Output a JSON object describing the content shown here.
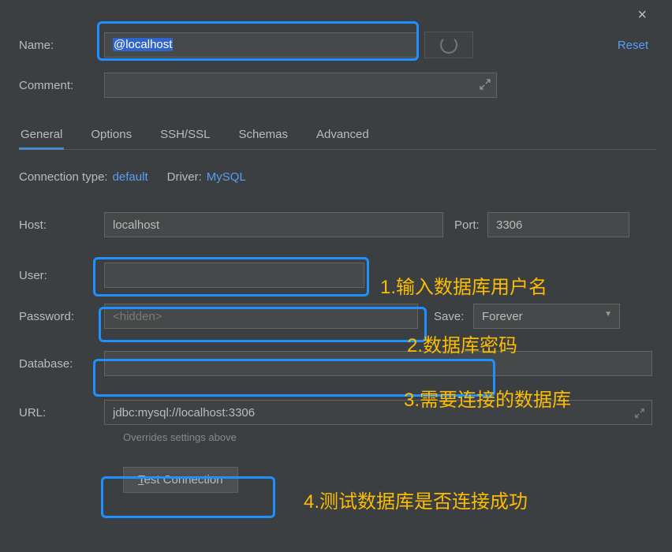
{
  "window": {
    "close_icon": "×",
    "reset_label": "Reset"
  },
  "fields": {
    "name_label": "Name:",
    "name_value": "@localhost",
    "comment_label": "Comment:",
    "comment_value": ""
  },
  "tabs": [
    {
      "label": "General",
      "active": true
    },
    {
      "label": "Options",
      "active": false
    },
    {
      "label": "SSH/SSL",
      "active": false
    },
    {
      "label": "Schemas",
      "active": false
    },
    {
      "label": "Advanced",
      "active": false
    }
  ],
  "connection": {
    "type_label": "Connection type:",
    "type_value": "default",
    "driver_label": "Driver:",
    "driver_value": "MySQL"
  },
  "form": {
    "host_label": "Host:",
    "host_value": "localhost",
    "port_label": "Port:",
    "port_value": "3306",
    "user_label": "User:",
    "user_value": "",
    "password_label": "Password:",
    "password_placeholder": "<hidden>",
    "save_label": "Save:",
    "save_value": "Forever",
    "database_label": "Database:",
    "database_value": "",
    "url_label": "URL:",
    "url_value": "jdbc:mysql://localhost:3306",
    "override_hint": "Overrides settings above",
    "test_button_prefix": "T",
    "test_button_rest": "est Connection"
  },
  "annotations": {
    "a1": "1.输入数据库用户名",
    "a2": "2.数据库密码",
    "a3": "3.需要连接的数据库",
    "a4": "4.测试数据库是否连接成功"
  }
}
